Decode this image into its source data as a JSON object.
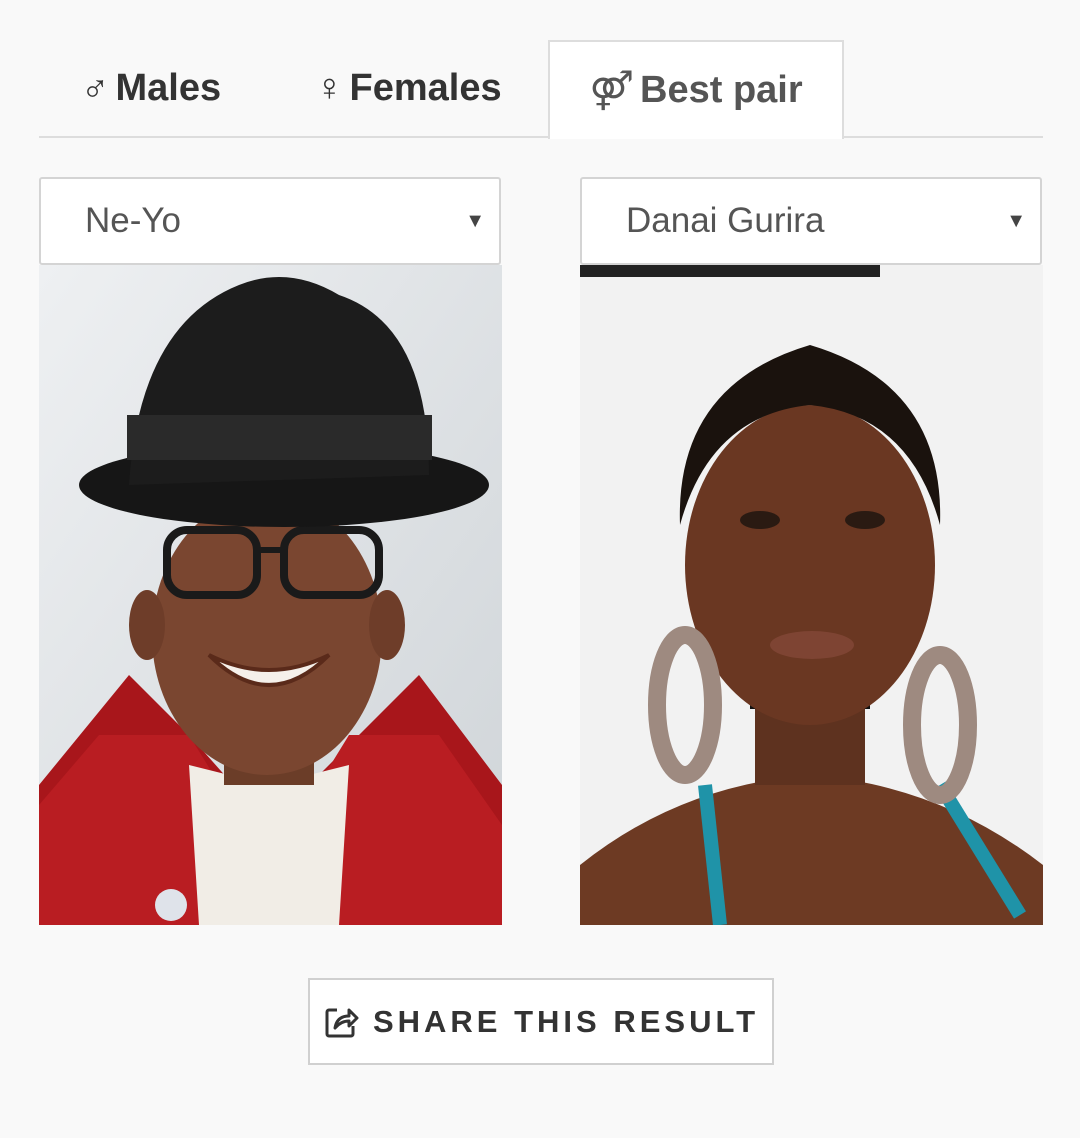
{
  "tabs": {
    "males": {
      "icon": "male-symbol-icon",
      "glyph": "♂",
      "label": "Males"
    },
    "females": {
      "icon": "female-symbol-icon",
      "glyph": "♀",
      "label": "Females"
    },
    "best_pair": {
      "icon": "pair-symbol-icon",
      "glyph": "⚤",
      "label": "Best pair",
      "active": true
    }
  },
  "selects": {
    "male": {
      "value": "Ne-Yo",
      "caret": "▼"
    },
    "female": {
      "value": "Danai Gurira",
      "caret": "▼"
    }
  },
  "photos": {
    "male": {
      "person": "Ne-Yo"
    },
    "female": {
      "person": "Danai Gurira"
    }
  },
  "share": {
    "icon": "share-icon",
    "label": "SHARE THIS RESULT"
  },
  "colors": {
    "background": "#f9f9f9",
    "tab_border": "#dddddd",
    "text_dark": "#333333",
    "select_text": "#555555"
  }
}
